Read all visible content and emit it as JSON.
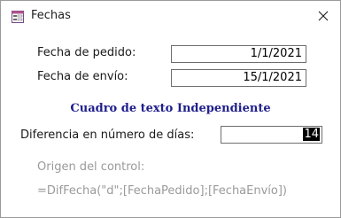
{
  "window": {
    "title": "Fechas",
    "icon": "form-icon",
    "close_glyph": "✕"
  },
  "form": {
    "order_date": {
      "label": "Fecha de pedido:",
      "value": "1/1/2021"
    },
    "ship_date": {
      "label": "Fecha de envío:",
      "value": "15/1/2021"
    },
    "section_title": "Cuadro de texto Independiente",
    "difference": {
      "label": "Diferencia en número de días:",
      "value": "14"
    },
    "control_source": {
      "label": "Origen del control:",
      "expression": "=DifFecha(\"d\";[FechaPedido];[FechaEnvío])"
    }
  },
  "colors": {
    "heading": "#1f1f8c",
    "muted_text": "#9a9a9a",
    "field_border": "#6e6e6e",
    "selection_bg": "#000000",
    "selection_fg": "#ffffff"
  }
}
